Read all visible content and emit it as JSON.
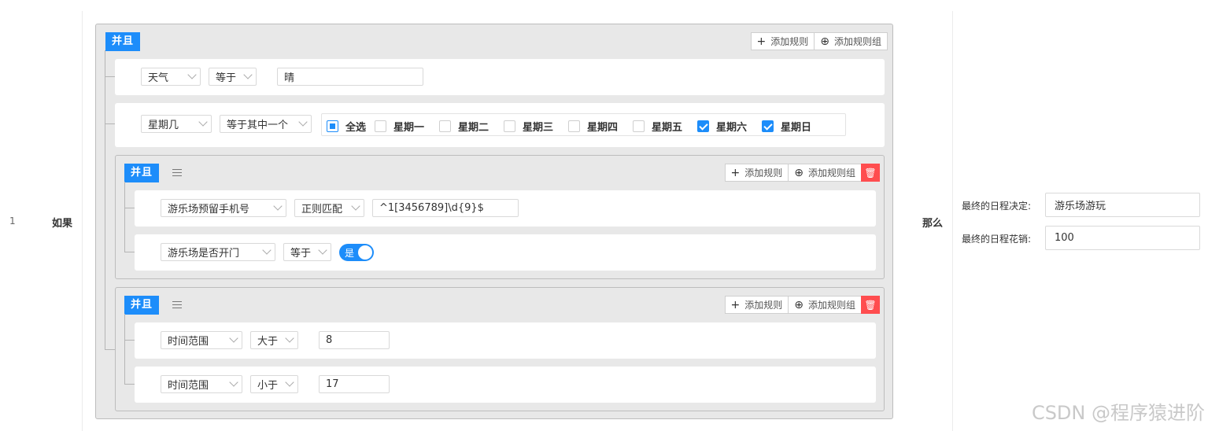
{
  "row_number": "1",
  "if_label": "如果",
  "then_label": "那么",
  "group_tag": "并且",
  "buttons": {
    "add_rule": "添加规则",
    "add_rule_group": "添加规则组"
  },
  "colors": {
    "accent": "#1d8dfa",
    "danger": "#ff4d4f",
    "group_bg": "#e8e8e8"
  },
  "rules": {
    "weather": {
      "field": "天气",
      "operator": "等于",
      "value": "晴"
    },
    "weekday": {
      "field": "星期几",
      "operator": "等于其中一个",
      "options": [
        {
          "label": "全选",
          "state": "indeterminate"
        },
        {
          "label": "星期一",
          "state": "unchecked"
        },
        {
          "label": "星期二",
          "state": "unchecked"
        },
        {
          "label": "星期三",
          "state": "unchecked"
        },
        {
          "label": "星期四",
          "state": "unchecked"
        },
        {
          "label": "星期五",
          "state": "unchecked"
        },
        {
          "label": "星期六",
          "state": "checked"
        },
        {
          "label": "星期日",
          "state": "checked"
        }
      ]
    }
  },
  "group1": {
    "rule1": {
      "field": "游乐场预留手机号",
      "operator": "正则匹配",
      "value": "^1[3456789]\\d{9}$"
    },
    "rule2": {
      "field": "游乐场是否开门",
      "operator": "等于",
      "switch_label": "是",
      "switch_on": true
    }
  },
  "group2": {
    "rule1": {
      "field": "时间范围",
      "operator": "大于",
      "value": "8"
    },
    "rule2": {
      "field": "时间范围",
      "operator": "小于",
      "value": "17"
    }
  },
  "result": {
    "decision_label": "最终的日程决定:",
    "decision_value": "游乐场游玩",
    "cost_label": "最终的日程花销:",
    "cost_value": "100"
  },
  "watermark": "CSDN @程序猿进阶"
}
